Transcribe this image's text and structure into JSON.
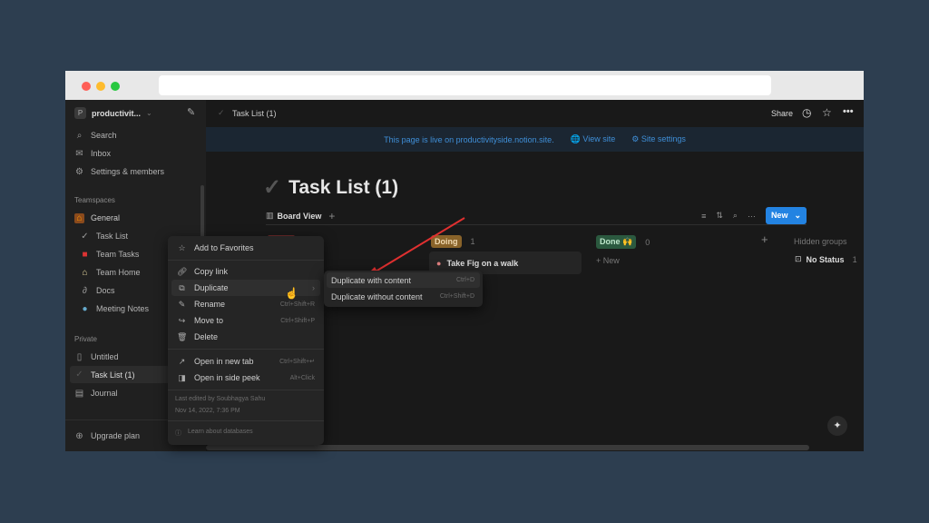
{
  "browser": {
    "colors": {
      "close": "#ff5f57",
      "minimize": "#febc2e",
      "maximize": "#28c840"
    }
  },
  "sidebar": {
    "workspace_initial": "P",
    "workspace": "productivit...",
    "items": [
      {
        "icon": "search-icon",
        "label": "Search"
      },
      {
        "icon": "inbox-icon",
        "label": "Inbox"
      },
      {
        "icon": "gear-icon",
        "label": "Settings & members"
      }
    ],
    "teamspaces_label": "Teamspaces",
    "general": "General",
    "team_items": [
      {
        "icon": "check-icon",
        "label": "Task List"
      },
      {
        "icon": "gift-icon",
        "label": "Team Tasks"
      },
      {
        "icon": "house-icon",
        "label": "Team Home"
      },
      {
        "icon": "paperclip-icon",
        "label": "Docs"
      },
      {
        "icon": "speech-bubble-icon",
        "label": "Meeting Notes"
      }
    ],
    "private_label": "Private",
    "private_items": [
      {
        "icon": "page-icon",
        "label": "Untitled"
      },
      {
        "icon": "check-icon",
        "label": "Task List (1)"
      },
      {
        "icon": "document-icon",
        "label": "Journal"
      }
    ],
    "upgrade": "Upgrade plan"
  },
  "topbar": {
    "breadcrumb": "Task List (1)",
    "share": "Share"
  },
  "banner": {
    "text": "This page is live on productivityside.notion.site.",
    "view_site": "View site",
    "site_settings": "Site settings"
  },
  "page": {
    "title": "Task List (1)",
    "view": "Board View",
    "new_button": "New"
  },
  "board": {
    "groups": [
      {
        "label": "Doing",
        "count": "1",
        "color": "#89632a",
        "cards": [
          "Take Fig on a walk"
        ]
      },
      {
        "label": "Done 🙌",
        "count": "0",
        "color": "#2b593f",
        "new_label": "+ New"
      }
    ],
    "hidden_groups": "Hidden groups",
    "no_status": "No Status",
    "no_status_count": "1"
  },
  "context_menu": {
    "items": [
      {
        "icon": "star-icon",
        "label": "Add to Favorites",
        "shortcut": ""
      },
      {
        "icon": "link-icon",
        "label": "Copy link",
        "shortcut": ""
      },
      {
        "icon": "duplicate-icon",
        "label": "Duplicate",
        "shortcut": ""
      },
      {
        "icon": "rename-icon",
        "label": "Rename",
        "shortcut": "Ctrl+Shift+R"
      },
      {
        "icon": "move-icon",
        "label": "Move to",
        "shortcut": "Ctrl+Shift+P"
      },
      {
        "icon": "trash-icon",
        "label": "Delete",
        "shortcut": ""
      },
      {
        "icon": "arrow-up-right-icon",
        "label": "Open in new tab",
        "shortcut": "Ctrl+Shift+↵"
      },
      {
        "icon": "side-peek-icon",
        "label": "Open in side peek",
        "shortcut": "Alt+Click"
      }
    ],
    "last_edited": "Last edited by Soubhagya Sahu",
    "edited_date": "Nov 14, 2022, 7:36 PM",
    "learn": "Learn about databases"
  },
  "submenu": {
    "items": [
      {
        "label": "Duplicate with content",
        "shortcut": "Ctrl+D"
      },
      {
        "label": "Duplicate without content",
        "shortcut": "Ctrl+Shift+D"
      }
    ]
  }
}
